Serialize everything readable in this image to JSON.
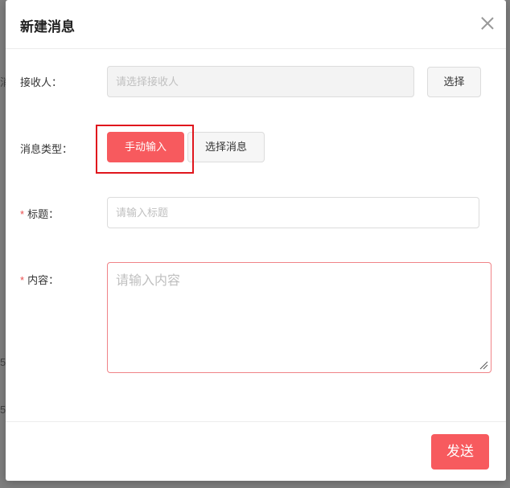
{
  "modal": {
    "title": "新建消息"
  },
  "form": {
    "recipient": {
      "label": "接收人：",
      "placeholder": "请选择接收人",
      "select_button": "选择"
    },
    "message_type": {
      "label": "消息类型：",
      "options": [
        "手动输入",
        "选择消息"
      ],
      "selected": "手动输入"
    },
    "title": {
      "required_mark": "*",
      "label": "标题：",
      "placeholder": "请输入标题"
    },
    "content": {
      "required_mark": "*",
      "label": "内容：",
      "placeholder": "请输入内容"
    }
  },
  "footer": {
    "send_label": "发送"
  },
  "background": {
    "left_fragments": [
      "消",
      "5",
      "5"
    ]
  },
  "colors": {
    "accent": "#f75a5e",
    "highlight_border": "#e0161d",
    "required": "#e94f4f"
  }
}
